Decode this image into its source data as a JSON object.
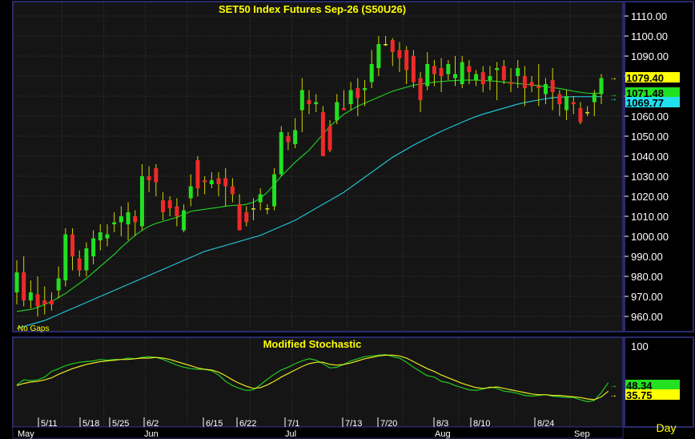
{
  "colors": {
    "background": "#000000",
    "panel": "#161616",
    "border": "#2a2a6a",
    "frame": "#ffffff",
    "grid": "#3c3c3c",
    "up_candle": "#22e022",
    "down_candle": "#ee2a2a",
    "doji": "#e0e020",
    "wick": "#d4d400",
    "ma_short": "#22c822",
    "ma_long": "#20c0d0",
    "stoch_k": "#22c822",
    "stoch_d": "#e8e820",
    "title": "#ffff00",
    "axis_text": "#ffffff",
    "price_tag_last": "#ffff00",
    "price_tag_ma_short": "#22e022",
    "price_tag_ma_long": "#20e0f0"
  },
  "chart_data": [
    {
      "type": "candlestick",
      "title": "SET50  Index  Futures  Sep-26  (S50U26)",
      "note": "No  Gaps",
      "ylim": [
        955,
        1120
      ],
      "y_ticks": [
        "960.00",
        "970.00",
        "980.00",
        "990.00",
        "1000.00",
        "1010.00",
        "1020.00",
        "1030.00",
        "1040.00",
        "1050.00",
        "1060.00",
        "1070.00",
        "1080.00",
        "1090.00",
        "1100.00",
        "1110.00"
      ],
      "price_tags": {
        "last": "1079.40",
        "ma_short": "1071.48",
        "ma_long": "1069.77"
      },
      "candles": [
        [
          972,
          982,
          988,
          966
        ],
        [
          982,
          968,
          990,
          965
        ],
        [
          968,
          972,
          978,
          964
        ],
        [
          971,
          965,
          980,
          960
        ],
        [
          968,
          966,
          975,
          961
        ],
        [
          968,
          966,
          972,
          963
        ],
        [
          973,
          979,
          985,
          969
        ],
        [
          978,
          1001,
          1004,
          975
        ],
        [
          1001,
          990,
          1004,
          983
        ],
        [
          989,
          983,
          993,
          980
        ],
        [
          983,
          994,
          997,
          980
        ],
        [
          990,
          999,
          1003,
          986
        ],
        [
          998,
          1002,
          1006,
          993
        ],
        [
          999,
          1001,
          1006,
          995
        ],
        [
          1006,
          1007,
          1012,
          1002
        ],
        [
          1007,
          1010,
          1015,
          1000
        ],
        [
          1006,
          1012,
          1017,
          998
        ],
        [
          1010,
          1007,
          1013,
          1000
        ],
        [
          1005,
          1030,
          1036,
          1003
        ],
        [
          1030,
          1028,
          1035,
          1022
        ],
        [
          1034,
          1027,
          1036,
          1020
        ],
        [
          1018,
          1012,
          1022,
          1008
        ],
        [
          1018,
          1014,
          1020,
          1010
        ],
        [
          1015,
          1010,
          1019,
          1005
        ],
        [
          1003,
          1013,
          1016,
          1002
        ],
        [
          1019,
          1025,
          1031,
          1015
        ],
        [
          1038,
          1024,
          1040,
          1020
        ],
        [
          1028,
          1027,
          1030,
          1021
        ],
        [
          1026,
          1028,
          1032,
          1024
        ],
        [
          1029,
          1026,
          1032,
          1020
        ],
        [
          1029,
          1025,
          1034,
          1015
        ],
        [
          1025,
          1021,
          1029,
          1017
        ],
        [
          1016,
          1003,
          1021,
          1005
        ],
        [
          1012,
          1007,
          1015,
          1005
        ],
        [
          1014,
          1014,
          1019,
          1008
        ],
        [
          1017,
          1021,
          1024,
          1013
        ],
        [
          1014,
          1014,
          1016,
          1011
        ],
        [
          1015,
          1031,
          1034,
          1013
        ],
        [
          1031,
          1052,
          1055,
          1030
        ],
        [
          1050,
          1047,
          1052,
          1043
        ],
        [
          1046,
          1053,
          1059,
          1044
        ],
        [
          1063,
          1073,
          1079,
          1052
        ],
        [
          1068,
          1066,
          1073,
          1061
        ],
        [
          1066,
          1067,
          1071,
          1062
        ],
        [
          1062,
          1040,
          1065,
          1040
        ],
        [
          1055,
          1043,
          1058,
          1042
        ],
        [
          1058,
          1067,
          1071,
          1056
        ],
        [
          1064,
          1063,
          1073,
          1063
        ],
        [
          1066,
          1073,
          1077,
          1063
        ],
        [
          1074,
          1069,
          1079,
          1060
        ],
        [
          1073,
          1074,
          1078,
          1065
        ],
        [
          1077,
          1086,
          1093,
          1074
        ],
        [
          1084,
          1096,
          1100,
          1080
        ],
        [
          1096,
          1096,
          1100,
          1095
        ],
        [
          1098,
          1092,
          1099,
          1085
        ],
        [
          1093,
          1089,
          1097,
          1082
        ],
        [
          1093,
          1083,
          1095,
          1076
        ],
        [
          1090,
          1077,
          1093,
          1074
        ],
        [
          1079,
          1068,
          1082,
          1062
        ],
        [
          1075,
          1086,
          1092,
          1073
        ],
        [
          1085,
          1081,
          1088,
          1075
        ],
        [
          1084,
          1080,
          1089,
          1072
        ],
        [
          1081,
          1086,
          1088,
          1078
        ],
        [
          1079,
          1081,
          1090,
          1075
        ],
        [
          1076,
          1087,
          1090,
          1074
        ],
        [
          1085,
          1082,
          1088,
          1076
        ],
        [
          1078,
          1081,
          1083,
          1075
        ],
        [
          1082,
          1076,
          1085,
          1072
        ],
        [
          1078,
          1080,
          1085,
          1073
        ],
        [
          1083,
          1084,
          1087,
          1068
        ],
        [
          1085,
          1078,
          1088,
          1076
        ],
        [
          1077,
          1076,
          1084,
          1072
        ],
        [
          1080,
          1084,
          1088,
          1074
        ],
        [
          1080,
          1074,
          1085,
          1065
        ],
        [
          1077,
          1075,
          1080,
          1072
        ],
        [
          1075,
          1074,
          1086,
          1065
        ],
        [
          1071,
          1076,
          1079,
          1066
        ],
        [
          1078,
          1072,
          1084,
          1063
        ],
        [
          1071,
          1066,
          1073,
          1060
        ],
        [
          1063,
          1070,
          1073,
          1058
        ],
        [
          1067,
          1066,
          1070,
          1061
        ],
        [
          1064,
          1057,
          1067,
          1056
        ],
        [
          1062,
          1062,
          1065,
          1060
        ],
        [
          1067,
          1071,
          1073,
          1060
        ],
        [
          1071,
          1079,
          1081,
          1066
        ]
      ],
      "ma_short": [
        962.5,
        963.0,
        963.5,
        964.5,
        966.0,
        967.5,
        969.5,
        971.5,
        974.0,
        976.5,
        979.0,
        982.0,
        985.0,
        988.0,
        991.0,
        994.5,
        997.5,
        1000.5,
        1003.0,
        1005.0,
        1006.5,
        1007.5,
        1008.5,
        1009.5,
        1011.0,
        1012.5,
        1013.0,
        1013.5,
        1014.0,
        1014.5,
        1015.0,
        1015.5,
        1015.5,
        1016.0,
        1017.0,
        1019.0,
        1022.0,
        1026.0,
        1030.0,
        1033.5,
        1037.0,
        1040.0,
        1043.0,
        1047.0,
        1051.0,
        1055.0,
        1058.0,
        1061.0,
        1063.0,
        1065.0,
        1066.5,
        1068.0,
        1069.5,
        1071.0,
        1072.5,
        1073.5,
        1074.5,
        1075.5,
        1076.0,
        1076.5,
        1077.0,
        1077.3,
        1077.6,
        1077.8,
        1078.0,
        1078.0,
        1078.0,
        1077.8,
        1077.6,
        1077.4,
        1077.0,
        1076.7,
        1076.3,
        1076.0,
        1075.6,
        1075.2,
        1074.8,
        1074.3,
        1073.8,
        1073.2,
        1072.5,
        1071.9,
        1071.5,
        1071.4,
        1071.5
      ],
      "ma_long": [
        954.0,
        955.0,
        956.0,
        957.0,
        958.0,
        959.5,
        961.0,
        962.5,
        964.0,
        965.5,
        967.0,
        968.5,
        970.0,
        971.5,
        973.0,
        974.5,
        976.0,
        977.5,
        979.0,
        980.5,
        982.0,
        983.5,
        985.0,
        986.5,
        988.0,
        989.5,
        991.0,
        992.5,
        993.5,
        994.5,
        995.5,
        996.5,
        997.5,
        998.5,
        999.5,
        1000.5,
        1002.0,
        1003.5,
        1005.0,
        1006.5,
        1008.0,
        1010.0,
        1012.0,
        1014.0,
        1016.0,
        1018.0,
        1020.0,
        1022.0,
        1024.5,
        1027.0,
        1029.5,
        1032.0,
        1034.5,
        1037.0,
        1039.5,
        1041.5,
        1043.5,
        1045.5,
        1047.3,
        1049.0,
        1050.7,
        1052.4,
        1054.0,
        1055.5,
        1057.0,
        1058.5,
        1059.8,
        1061.0,
        1062.0,
        1063.0,
        1064.0,
        1065.0,
        1066.0,
        1066.8,
        1067.5,
        1068.1,
        1068.7,
        1069.2,
        1069.5,
        1069.6,
        1069.7,
        1069.7,
        1069.7,
        1069.7,
        1069.8
      ]
    },
    {
      "type": "line",
      "title": "Modified  Stochastic",
      "ylim": [
        0,
        100
      ],
      "y_ticks": [
        "100"
      ],
      "value_tags": {
        "k": "48.34",
        "d": "35.75"
      },
      "series": [
        {
          "key": "k",
          "values": [
            45,
            52,
            51,
            52,
            56,
            64,
            68,
            72,
            75,
            77,
            78,
            79,
            81,
            80,
            81,
            81,
            83,
            82,
            84,
            85,
            84,
            81,
            77,
            73,
            70,
            68,
            67,
            67,
            65,
            59,
            50,
            44,
            40,
            37,
            38,
            45,
            53,
            60,
            66,
            70,
            75,
            79,
            82,
            80,
            75,
            69,
            70,
            74,
            79,
            82,
            85,
            86,
            87,
            88,
            85,
            83,
            77,
            70,
            64,
            58,
            56,
            50,
            48,
            44,
            41,
            38,
            37,
            39,
            42,
            40,
            36,
            35,
            33,
            30,
            29,
            30,
            31,
            29,
            28,
            27,
            27,
            24,
            21,
            23,
            34,
            48
          ]
        },
        {
          "key": "d",
          "values": [
            44,
            47,
            49,
            50,
            52,
            55,
            60,
            64,
            68,
            71,
            74,
            76,
            78,
            79,
            80,
            81,
            81,
            82,
            83,
            83,
            84,
            83,
            81,
            78,
            75,
            72,
            69,
            67,
            66,
            63,
            58,
            52,
            47,
            43,
            40,
            41,
            45,
            50,
            56,
            61,
            66,
            71,
            75,
            77,
            77,
            74,
            73,
            74,
            76,
            79,
            82,
            84,
            86,
            87,
            87,
            86,
            83,
            78,
            73,
            68,
            64,
            59,
            55,
            51,
            47,
            44,
            41,
            40,
            41,
            42,
            40,
            38,
            36,
            34,
            32,
            31,
            31,
            30,
            30,
            29,
            28,
            27,
            25,
            24,
            28,
            36
          ]
        }
      ],
      "x_tick_labels": [
        "5/11",
        "5/18",
        "5/25",
        "6/2",
        "6/15",
        "6/22",
        "7/1",
        "7/13",
        "7/20",
        "8/3",
        "8/10",
        "8/24"
      ],
      "month_labels": [
        "May",
        "Jun",
        "Jul",
        "Aug",
        "Sep"
      ],
      "x_axis_label": "Day"
    }
  ]
}
